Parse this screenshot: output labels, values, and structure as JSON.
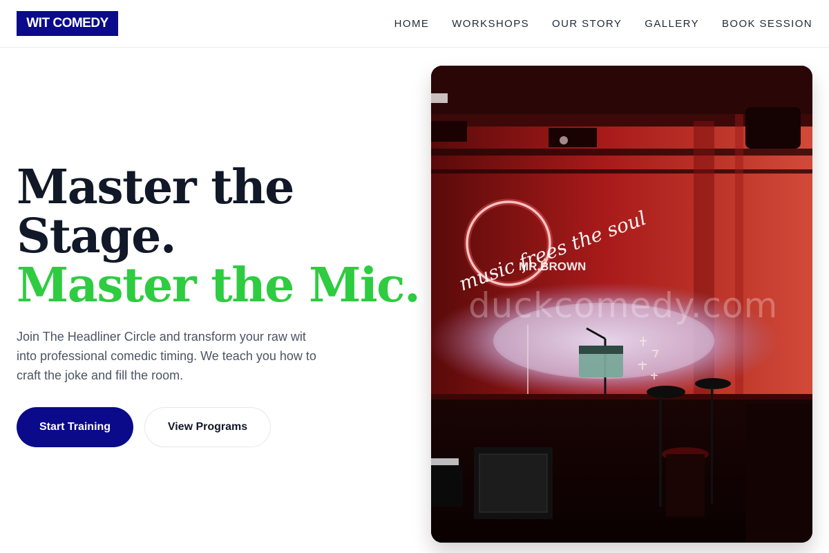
{
  "brand": {
    "logo_text": "WIT COMEDY",
    "primary_color": "#0a0a8a",
    "accent_color": "#2ecc40"
  },
  "nav": {
    "items": [
      {
        "label": "HOME"
      },
      {
        "label": "WORKSHOPS"
      },
      {
        "label": "OUR STORY"
      },
      {
        "label": "GALLERY"
      },
      {
        "label": "BOOK SESSION"
      }
    ]
  },
  "hero": {
    "title_line1": "Master the",
    "title_line2": "Stage.",
    "title_accent": "Master the Mic.",
    "subtitle": "Join The Headliner Circle and transform your raw wit into professional comedic timing. We teach you how to craft the joke and fill the room.",
    "cta_primary": "Start Training",
    "cta_secondary": "View Programs"
  },
  "image": {
    "neon_script": "music frees the soul",
    "neon_name": "MR.BROWN",
    "watermark": "duckcomedy.com"
  }
}
